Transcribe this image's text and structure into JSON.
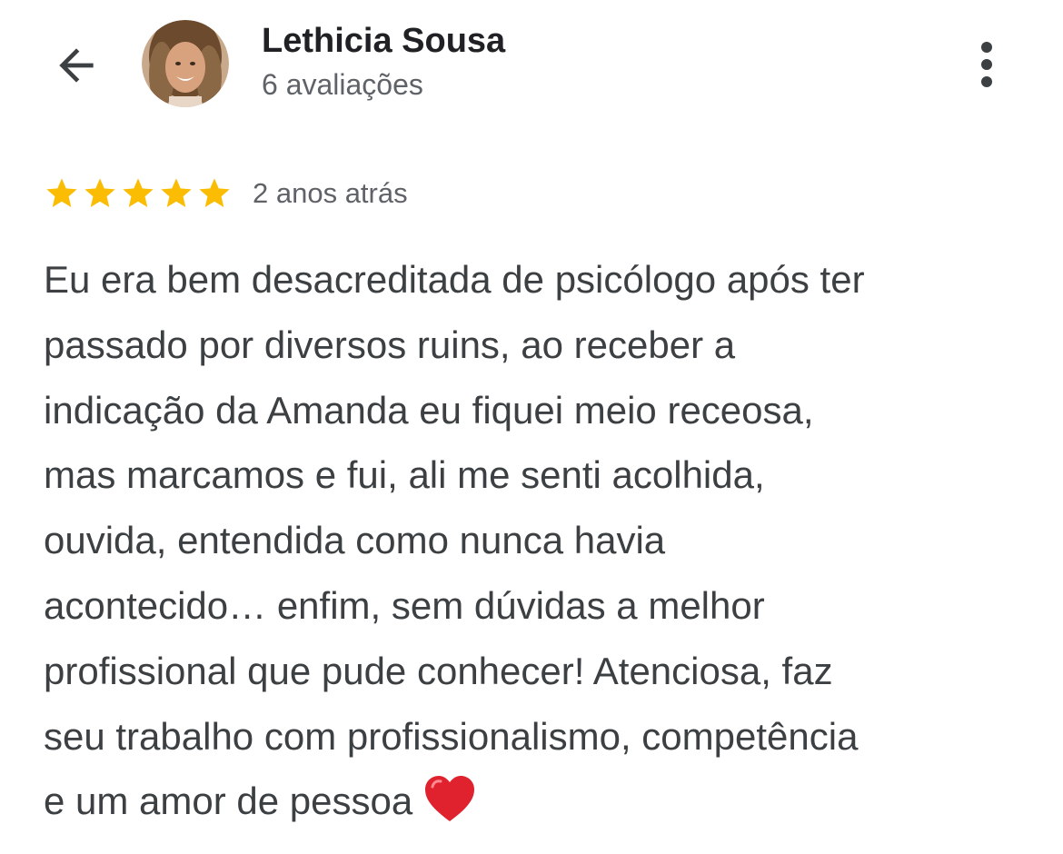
{
  "header": {
    "reviewer_name": "Lethicia Sousa",
    "review_count": "6 avaliações",
    "back_icon": "arrow-back-icon",
    "more_icon": "more-vert-icon"
  },
  "review": {
    "rating": 5,
    "rating_max": 5,
    "star_color": "#fbbc04",
    "date": "2 anos atrás",
    "text_lines": [
      "Eu era bem desacreditada de psicólogo após ter",
      "passado por diversos ruins, ao receber a",
      "indicação da Amanda eu fiquei meio receosa,",
      "mas marcamos e fui, ali me senti acolhida,",
      "ouvida, entendida como nunca havia",
      "acontecido… enfim, sem dúvidas a melhor",
      "profissional que pude conhecer! Atenciosa, faz",
      "seu trabalho com profissionalismo, competência",
      "e um amor de pessoa"
    ],
    "end_icon": "red-heart-icon"
  }
}
